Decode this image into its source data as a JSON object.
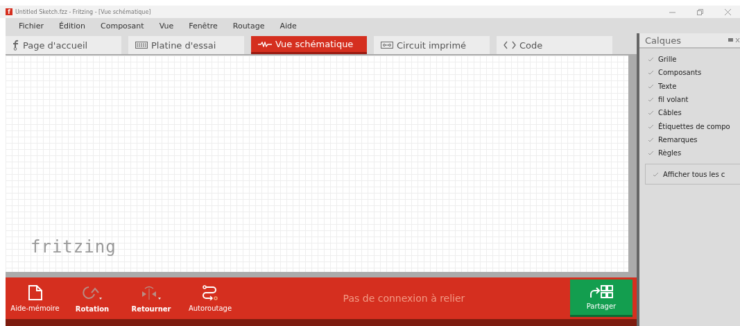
{
  "window": {
    "title": "Untitled Sketch.fzz - Fritzing - [Vue schématique]",
    "app_icon": "f"
  },
  "menu": [
    "Fichier",
    "Édition",
    "Composant",
    "Vue",
    "Fenêtre",
    "Routage",
    "Aide"
  ],
  "tabs": [
    {
      "label": "Page d'accueil",
      "kind": "home",
      "selected": false
    },
    {
      "label": "Platine d'essai",
      "kind": "breadboard",
      "selected": false
    },
    {
      "label": "Vue schématique",
      "kind": "schematic",
      "selected": true
    },
    {
      "label": "Circuit imprimé",
      "kind": "pcb",
      "selected": false
    },
    {
      "label": "Code",
      "kind": "code",
      "selected": false
    }
  ],
  "canvas": {
    "logo": "fritzing"
  },
  "toolbar": {
    "tools": [
      {
        "label": "Aide-mémoire",
        "kind": "note",
        "disabled": false
      },
      {
        "label": "Rotation",
        "kind": "rotate",
        "disabled": true
      },
      {
        "label": "Retourner",
        "kind": "flip",
        "disabled": true
      },
      {
        "label": "Autoroutage",
        "kind": "autoroute",
        "disabled": false
      }
    ],
    "status": "Pas de connexion à relier",
    "share": "Partager"
  },
  "layers": {
    "title": "Calques",
    "items": [
      {
        "label": "Grille",
        "checked": true
      },
      {
        "label": "Composants",
        "checked": true
      },
      {
        "label": "Texte",
        "checked": true
      },
      {
        "label": "fil volant",
        "checked": true
      },
      {
        "label": "Câbles",
        "checked": true
      },
      {
        "label": "Étiquettes de compo",
        "checked": true
      },
      {
        "label": "Remarques",
        "checked": true
      },
      {
        "label": "Règles",
        "checked": true
      }
    ],
    "show_all": {
      "label": "Afficher tous les c",
      "checked": true
    }
  }
}
